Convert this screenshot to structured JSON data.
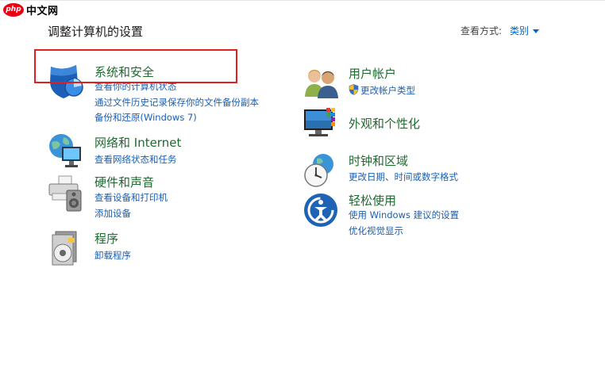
{
  "watermark": {
    "logo_text": "php",
    "site_text": "中文网"
  },
  "page": {
    "title": "调整计算机的设置"
  },
  "view_by": {
    "label": "查看方式:",
    "value": "类别"
  },
  "categories": {
    "security": {
      "title": "系统和安全",
      "links": [
        "查看你的计算机状态",
        "通过文件历史记录保存你的文件备份副本",
        "备份和还原(Windows 7)"
      ]
    },
    "network": {
      "title": "网络和 Internet",
      "links": [
        "查看网络状态和任务"
      ]
    },
    "hardware": {
      "title": "硬件和声音",
      "links": [
        "查看设备和打印机",
        "添加设备"
      ]
    },
    "programs": {
      "title": "程序",
      "links": [
        "卸载程序"
      ]
    },
    "accounts": {
      "title": "用户帐户",
      "links": [
        "更改帐户类型"
      ]
    },
    "appearance": {
      "title": "外观和个性化",
      "links": []
    },
    "clock": {
      "title": "时钟和区域",
      "links": [
        "更改日期、时间或数字格式"
      ]
    },
    "ease": {
      "title": "轻松使用",
      "links": [
        "使用 Windows 建议的设置",
        "优化视觉显示"
      ]
    }
  },
  "colors": {
    "title_green": "#1e6a2f",
    "link_blue": "#1a5fb4",
    "highlight_red": "#e02020"
  }
}
